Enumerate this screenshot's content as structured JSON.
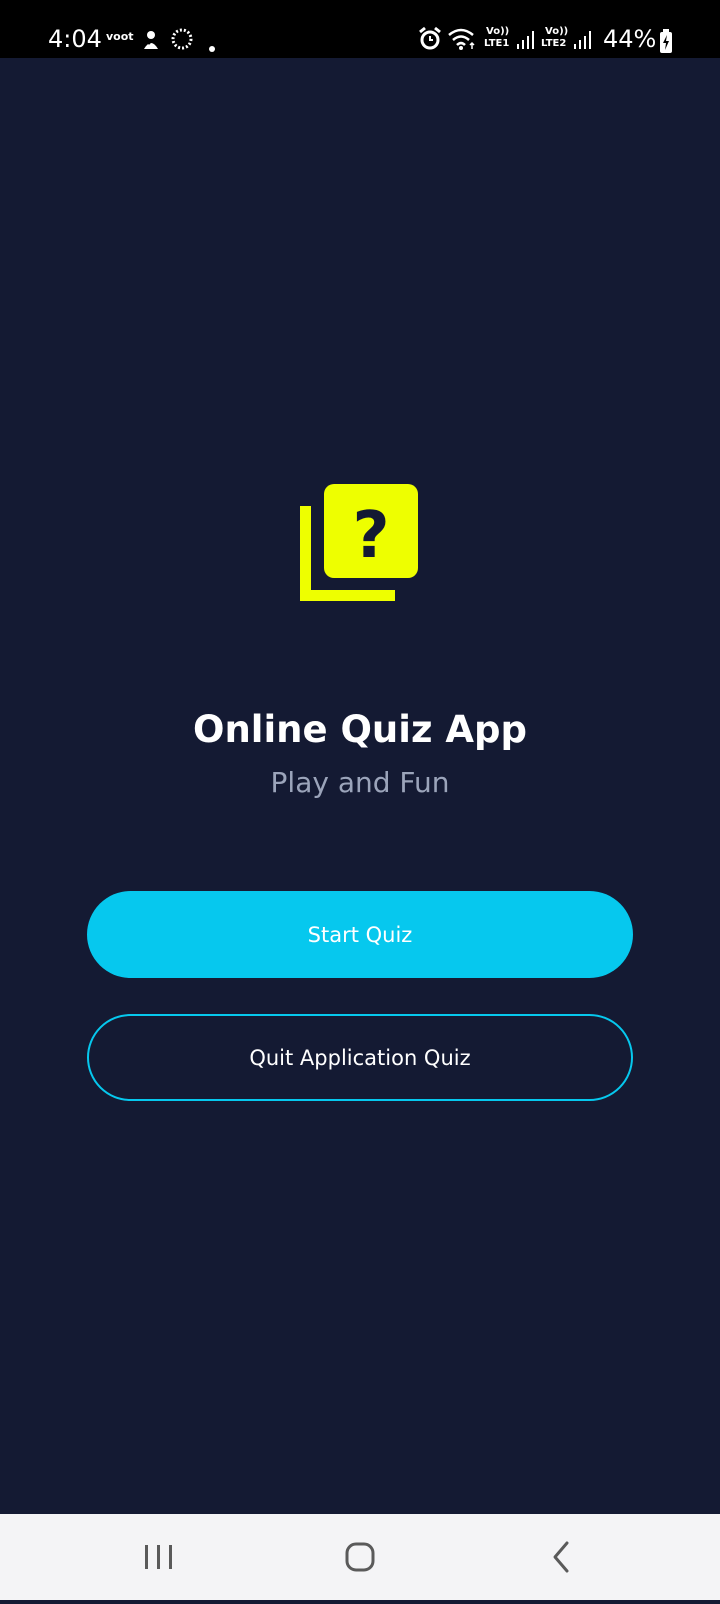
{
  "status_bar": {
    "time": "4:04",
    "app_label": "voot",
    "sim1": "LTE1",
    "sim2": "LTE2",
    "volte1": "Vo))",
    "volte2": "Vo))",
    "battery": "44%"
  },
  "main": {
    "title": "Online Quiz App",
    "subtitle": "Play and Fun",
    "logo_icon": "quiz-question-icon",
    "start_button": "Start Quiz",
    "quit_button": "Quit Application Quiz"
  },
  "nav_bar": {
    "recents": "recents-icon",
    "home": "home-icon",
    "back": "back-icon"
  },
  "colors": {
    "background": "#141a33",
    "accent": "#06c8ee",
    "logo": "#eeff00",
    "subtitle": "#9ba4ba"
  }
}
